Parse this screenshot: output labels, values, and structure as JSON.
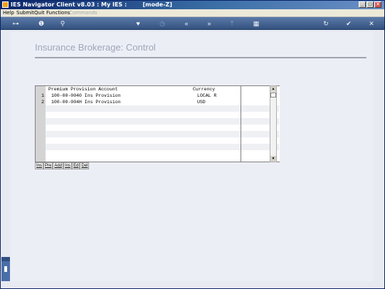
{
  "window": {
    "title": "IES Navigator Client v8.03 : My IES :",
    "mode": "[mode-Z]",
    "buttons": [
      "minimize",
      "maximize",
      "close"
    ]
  },
  "menu": {
    "items": [
      "Help",
      "Submit",
      "Quit",
      "Functions",
      "Commands"
    ],
    "disabled": [
      "Commands"
    ]
  },
  "toolbar": {
    "icons": [
      "key-icon",
      "info-icon",
      "search-icon",
      "heart-icon",
      "history-icon",
      "rewind-icon",
      "fast-forward-icon",
      "upload-icon",
      "grid-icon",
      "refresh-icon",
      "check-icon",
      "close-icon"
    ]
  },
  "page": {
    "title": "Insurance Brokerage: Control"
  },
  "grid": {
    "columns": [
      "Premium Provision Account",
      "Currency"
    ],
    "rows": [
      {
        "num": "1",
        "account": "100-00-0040 Ins Provision",
        "currency": "LOCAL R"
      },
      {
        "num": "2",
        "account": "100-00-004H Ins Provision",
        "currency": "USD"
      }
    ],
    "buttons": [
      "Ins",
      "Pre",
      "Add",
      "Ins",
      "Ed",
      "Del"
    ]
  },
  "colors": {
    "titlebar_start": "#0a246a",
    "toolbar": "#4a6a98",
    "page_title": "#9ea6b8",
    "background": "#eceef6"
  }
}
